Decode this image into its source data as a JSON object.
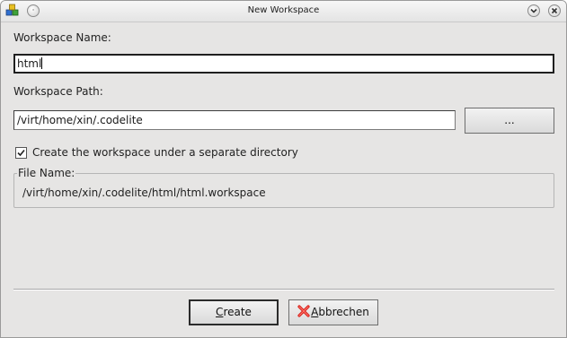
{
  "window": {
    "title": "New Workspace"
  },
  "form": {
    "name_label": "Workspace Name:",
    "name_value": "html",
    "path_label": "Workspace Path:",
    "path_value": "/virt/home/xin/.codelite",
    "browse_label": "...",
    "separate_dir_label": "Create the workspace under a separate directory",
    "separate_dir_checked": true,
    "filename_group_label": "File Name:",
    "filename_value": "/virt/home/xin/.codelite/html/html.workspace"
  },
  "buttons": {
    "create_mnemonic": "C",
    "create_rest": "reate",
    "cancel_mnemonic": "A",
    "cancel_rest": "bbrechen"
  },
  "colors": {
    "dialog_bg": "#e6e5e4",
    "cancel_icon": "#d9221c"
  }
}
